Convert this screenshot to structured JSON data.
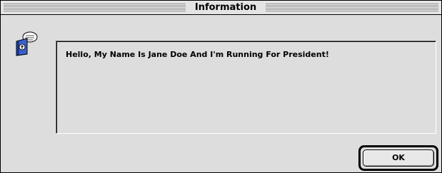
{
  "window": {
    "title": "Information"
  },
  "dialog": {
    "icon": "information-speech-icon",
    "message": "Hello, My Name Is Jane Doe And I'm Running For President!",
    "ok_label": "OK"
  }
}
